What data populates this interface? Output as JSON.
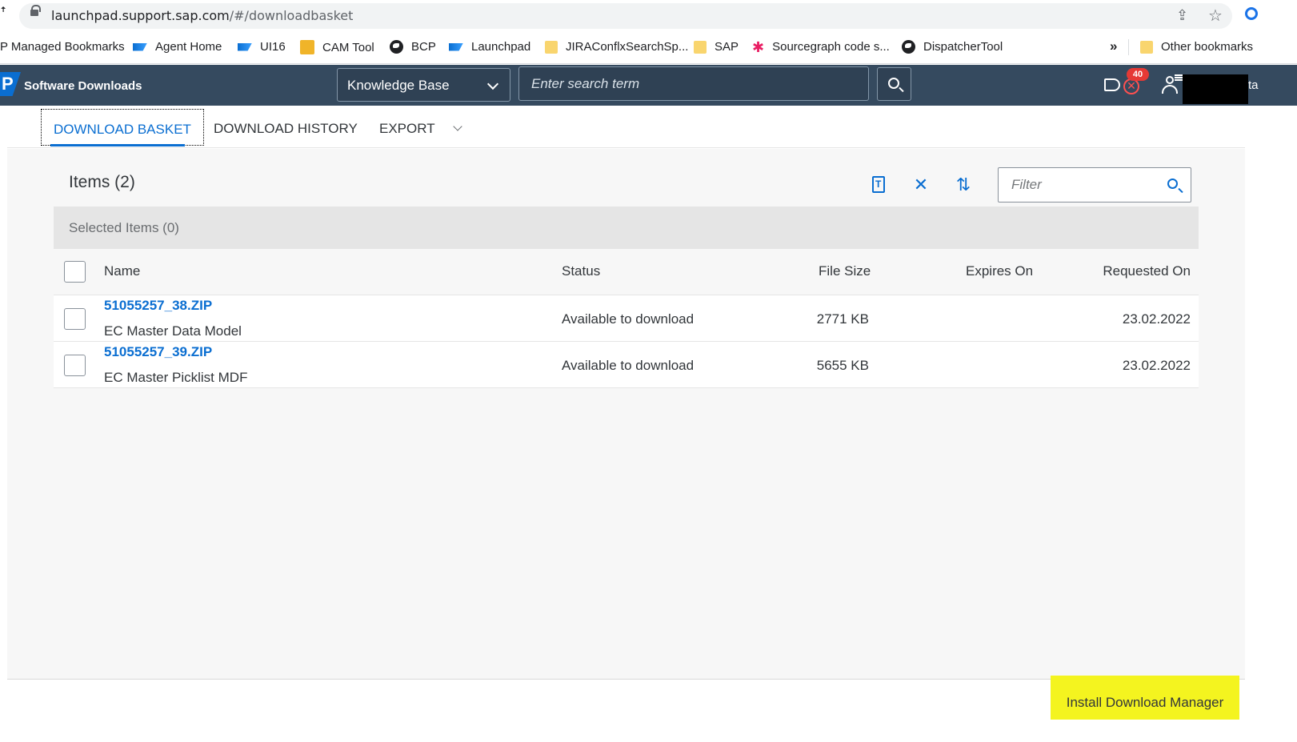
{
  "browser": {
    "url_host": "launchpad.support.sap.com",
    "url_path": "/#/downloadbasket",
    "left_glyph": "ꜛ"
  },
  "bookmarks": [
    {
      "label": "P Managed Bookmarks",
      "icon": "none"
    },
    {
      "label": "Agent Home",
      "icon": "sap-icon"
    },
    {
      "label": "UI16",
      "icon": "sap-icon"
    },
    {
      "label": "CAM Tool",
      "icon": "cam-icon"
    },
    {
      "label": "BCP",
      "icon": "globe-icon"
    },
    {
      "label": "Launchpad",
      "icon": "sap-icon"
    },
    {
      "label": "JIRAConflxSearchSp...",
      "icon": "folder-icon"
    },
    {
      "label": "SAP",
      "icon": "folder-icon"
    },
    {
      "label": "Sourcegraph code s...",
      "icon": "sourcegraph-icon"
    },
    {
      "label": "DispatcherTool",
      "icon": "globe-icon"
    },
    {
      "label": "Other bookmarks",
      "icon": "folder-icon"
    }
  ],
  "bookmarks_overflow": "»",
  "shell": {
    "logo": "P",
    "title": "Software Downloads",
    "search_scope": "Knowledge Base",
    "search_placeholder": "Enter search term",
    "notification_count": "40",
    "trail_text": "ta"
  },
  "tabs": [
    {
      "label": "DOWNLOAD BASKET",
      "active": true
    },
    {
      "label": "DOWNLOAD HISTORY",
      "active": false
    },
    {
      "label": "EXPORT",
      "active": false
    }
  ],
  "basket": {
    "title": "Items (2)",
    "selected": "Selected Items (0)",
    "filter_placeholder": "Filter",
    "columns": {
      "name": "Name",
      "status": "Status",
      "size": "File Size",
      "expires": "Expires On",
      "requested": "Requested On"
    },
    "rows": [
      {
        "file": "51055257_38.ZIP",
        "desc": "EC Master Data Model",
        "status": "Available to download",
        "size": "2771 KB",
        "expires": "",
        "requested": "23.02.2022"
      },
      {
        "file": "51055257_39.ZIP",
        "desc": "EC Master Picklist MDF",
        "status": "Available to download",
        "size": "5655 KB",
        "expires": "",
        "requested": "23.02.2022"
      }
    ]
  },
  "footer": {
    "install_label": "Install Download Manager"
  },
  "colors": {
    "shell_bg": "#354a5f",
    "brand_blue": "#0a6ed1",
    "highlight": "#f4f41f"
  }
}
